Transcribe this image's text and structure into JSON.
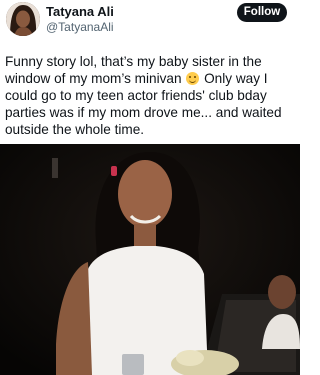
{
  "author": {
    "display_name": "Tatyana Ali",
    "handle": "@TatyanaAli"
  },
  "follow_button": {
    "label": "Follow"
  },
  "tweet": {
    "text_before_emoji": "Funny story lol, that’s my baby sister in the\nwindow of my mom’s minivan",
    "text_after_emoji": " Only way I\ncould go to my teen actor friends' club bday\nparties was if my mom drove me... and waited\noutside the whole time.",
    "emoji_icon": "grinning-sweat-face-icon"
  },
  "photo": {
    "icon": "tweet-photo"
  },
  "colors": {
    "text": "#0f1419",
    "secondary_text": "#536471",
    "follow_button_bg": "#0f1419",
    "background": "#ffffff"
  }
}
